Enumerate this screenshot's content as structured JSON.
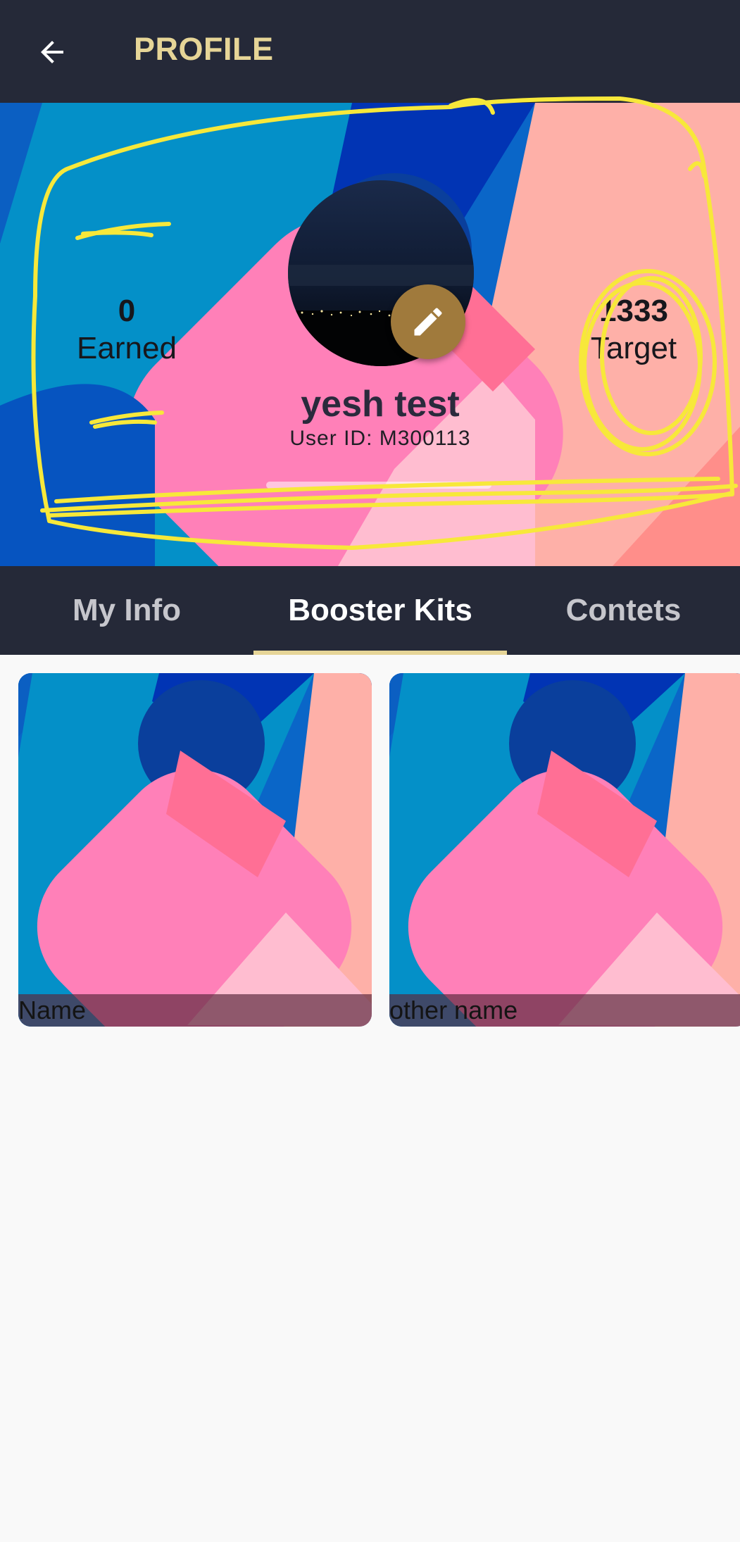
{
  "app_bar": {
    "title": "PROFILE",
    "back_icon": "arrow-back-icon"
  },
  "profile": {
    "earned_value": "0",
    "earned_label": "Earned",
    "target_value": "1333",
    "target_label": "Target",
    "name": "yesh test",
    "user_id": "User ID: M300113",
    "progress_fraction": 0,
    "edit_icon": "pencil-icon"
  },
  "tabs": [
    {
      "label": "My Info",
      "active": false
    },
    {
      "label": "Booster Kits",
      "active": true
    },
    {
      "label": "Contets",
      "active": false
    }
  ],
  "cards": [
    {
      "caption": "Name"
    },
    {
      "caption": "other name"
    }
  ],
  "colors": {
    "app_bar_bg": "#252938",
    "title_accent": "#e6d597",
    "edit_button": "#a07a3c",
    "annotation_yellow": "#f7e83a"
  }
}
